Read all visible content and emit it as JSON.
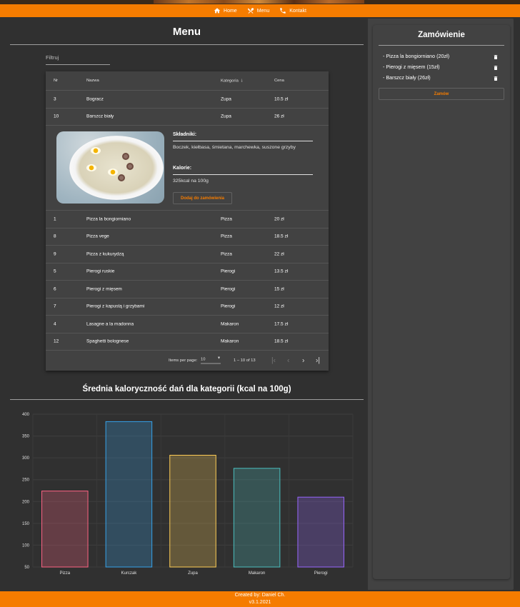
{
  "nav": {
    "items": [
      {
        "label": "Home",
        "icon": "home-icon"
      },
      {
        "label": "Menu",
        "icon": "cutlery-icon"
      },
      {
        "label": "Kontakt",
        "icon": "phone-icon"
      }
    ]
  },
  "menu": {
    "title": "Menu",
    "filter_placeholder": "Filtruj",
    "columns": {
      "nr": "Nr",
      "name": "Nazwa",
      "category": "Kategoria",
      "price": "Cena"
    },
    "rows_top": [
      {
        "nr": "3",
        "name": "Bogracz",
        "category": "Zupa",
        "price": "10.5 zł"
      },
      {
        "nr": "10",
        "name": "Barszcz biały",
        "category": "Zupa",
        "price": "26 zł"
      }
    ],
    "detail": {
      "ingredients_label": "Składniki:",
      "ingredients": "Boczek, kiełbasa, śmietana, marchewka, suszone grzyby",
      "calories_label": "Kalorie:",
      "calories": "325kcal na 100g",
      "add_button": "Dodaj do zamówienia"
    },
    "rows_bottom": [
      {
        "nr": "1",
        "name": "Pizza la bongiorniano",
        "category": "Pizza",
        "price": "20 zł"
      },
      {
        "nr": "8",
        "name": "Pizza vege",
        "category": "Pizza",
        "price": "18.5 zł"
      },
      {
        "nr": "9",
        "name": "Pizza z kukurydzą",
        "category": "Pizza",
        "price": "22 zł"
      },
      {
        "nr": "5",
        "name": "Pierogi ruskie",
        "category": "Pierogi",
        "price": "13.5 zł"
      },
      {
        "nr": "6",
        "name": "Pierogi z mięsem",
        "category": "Pierogi",
        "price": "15 zł"
      },
      {
        "nr": "7",
        "name": "Pierogi z kapustą i grzybami",
        "category": "Pierogi",
        "price": "12 zł"
      },
      {
        "nr": "4",
        "name": "Lasagne a la madonna",
        "category": "Makaron",
        "price": "17.5 zł"
      },
      {
        "nr": "12",
        "name": "Spaghetti bolognese",
        "category": "Makaron",
        "price": "18.5 zł"
      }
    ],
    "paginator": {
      "items_per_page_label": "Items per page:",
      "page_size": "10",
      "range": "1 – 10 of 13"
    }
  },
  "chart_data": {
    "type": "bar",
    "title": "Średnia kaloryczność dań dla kategorii (kcal na 100g)",
    "categories": [
      "Pizza",
      "Kurczak",
      "Zupa",
      "Makaron",
      "Pierogi"
    ],
    "values": [
      224,
      383,
      306,
      276,
      210
    ],
    "colors": [
      "#ff6384",
      "#36a2eb",
      "#ffce56",
      "#4bc0c0",
      "#9966ff"
    ],
    "yticks": [
      "400",
      "350",
      "300",
      "250",
      "200",
      "150",
      "100",
      "50"
    ],
    "ylim": [
      50,
      400
    ],
    "grid": true
  },
  "order": {
    "title": "Zamówienie",
    "items": [
      {
        "label": "- Pizza la bongiorniano (20zł)"
      },
      {
        "label": "- Pierogi z mięsem (15zł)"
      },
      {
        "label": "- Barszcz biały (26zł)"
      }
    ],
    "submit": "Zamów"
  },
  "footer": {
    "line1": "Created by: Daniel Ch.",
    "line2": "v3.1.2021"
  },
  "colors": {
    "accent": "#f57c00",
    "background": "#303030",
    "card": "#424242"
  }
}
